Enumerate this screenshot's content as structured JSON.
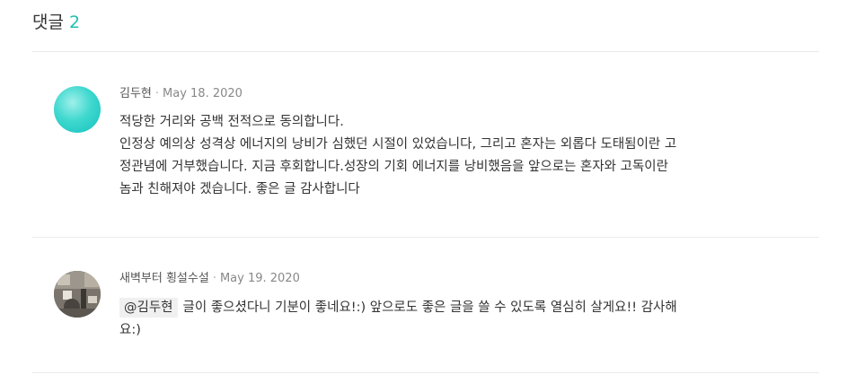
{
  "comments_section": {
    "title": "댓글",
    "count": "2"
  },
  "comments": [
    {
      "author": "김두현",
      "separator": "·",
      "date": "May 18. 2020",
      "lines": [
        "적당한 거리와 공백 전적으로 동의합니다.",
        "인정상 예의상 성격상 에너지의 낭비가 심했던 시절이 있었습니다, 그리고 혼자는 외롭다 도태됨이란 고",
        "정관념에 거부했습니다. 지금 후회합니다.성장의 기회 에너지를 낭비했음을 앞으로는 혼자와 고독이란",
        "놈과 친해져야 겠습니다. 좋은 글 감사합니다"
      ]
    },
    {
      "author": "새벽부터 횡설수설",
      "separator": "·",
      "date": "May 19. 2020",
      "mention": "@김두현",
      "lines": [
        "글이 좋으셨다니 기분이 좋네요!:) 앞으로도 좋은 글을 쓸 수 있도록 열심히 살게요!! 감사해",
        "요:)"
      ]
    }
  ]
}
